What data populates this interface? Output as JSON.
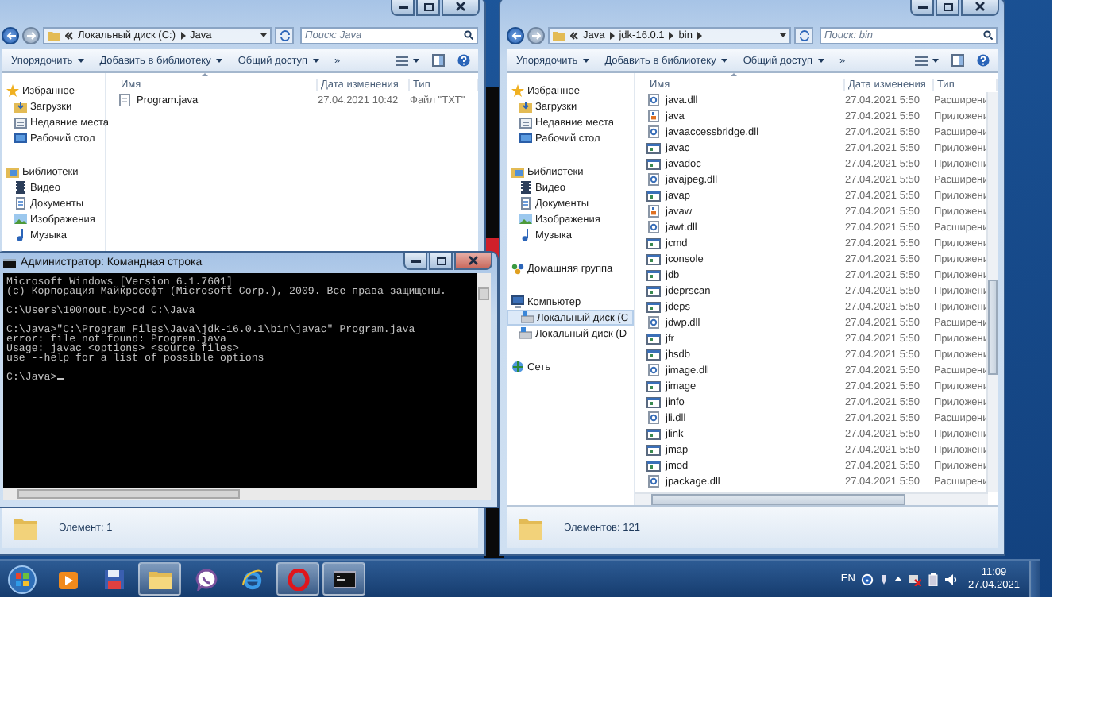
{
  "explorers": [
    {
      "address": {
        "crumbs": [
          "Локальный диск (C:)",
          "Java"
        ],
        "trailing_separator": false
      },
      "search": {
        "placeholder": "Поиск: Java"
      },
      "toolbar": [
        {
          "label": "Упорядочить"
        },
        {
          "label": "Добавить в библиотеку"
        },
        {
          "label": "Общий доступ"
        }
      ],
      "more": "»",
      "nav": [
        {
          "label": "Избранное",
          "kind": "favorites",
          "selected": false,
          "children": [
            {
              "label": "Загрузки",
              "kind": "downloads",
              "selected": false
            },
            {
              "label": "Недавние места",
              "kind": "recent",
              "selected": false
            },
            {
              "label": "Рабочий стол",
              "kind": "desktop",
              "selected": false
            }
          ]
        },
        {
          "label": "Библиотеки",
          "kind": "libraries",
          "selected": false,
          "children": [
            {
              "label": "Видео",
              "kind": "video",
              "selected": false
            },
            {
              "label": "Документы",
              "kind": "documents",
              "selected": false
            },
            {
              "label": "Изображения",
              "kind": "images",
              "selected": false
            },
            {
              "label": "Музыка",
              "kind": "music",
              "selected": false
            }
          ]
        }
      ],
      "columns": [
        "Имя",
        "Дата изменения",
        "Тип"
      ],
      "rows": [
        {
          "name": "Program.java",
          "date": "27.04.2021 10:42",
          "type": "Файл \"TXT\"",
          "kind": "text"
        }
      ],
      "status": "Элемент: 1"
    },
    {
      "address": {
        "crumbs": [
          "Java",
          "jdk-16.0.1",
          "bin"
        ],
        "trailing_separator": true
      },
      "search": {
        "placeholder": "Поиск: bin"
      },
      "toolbar": [
        {
          "label": "Упорядочить"
        },
        {
          "label": "Добавить в библиотеку"
        },
        {
          "label": "Общий доступ"
        }
      ],
      "more": "»",
      "nav": [
        {
          "label": "Избранное",
          "kind": "favorites",
          "selected": false,
          "children": [
            {
              "label": "Загрузки",
              "kind": "downloads",
              "selected": false
            },
            {
              "label": "Недавние места",
              "kind": "recent",
              "selected": false
            },
            {
              "label": "Рабочий стол",
              "kind": "desktop",
              "selected": false
            }
          ]
        },
        {
          "label": "Библиотеки",
          "kind": "libraries",
          "selected": false,
          "children": [
            {
              "label": "Видео",
              "kind": "video",
              "selected": false
            },
            {
              "label": "Документы",
              "kind": "documents",
              "selected": false
            },
            {
              "label": "Изображения",
              "kind": "images",
              "selected": false
            },
            {
              "label": "Музыка",
              "kind": "music",
              "selected": false
            }
          ]
        },
        {
          "label": "Домашняя группа",
          "kind": "homegroup",
          "selected": false
        },
        {
          "label": "Компьютер",
          "kind": "computer",
          "selected": false,
          "children": [
            {
              "label": "Локальный диск (C",
              "kind": "drive",
              "selected": true
            },
            {
              "label": "Локальный диск (D",
              "kind": "drive",
              "selected": false
            }
          ]
        },
        {
          "label": "Сеть",
          "kind": "network",
          "selected": false
        }
      ],
      "columns": [
        "Имя",
        "Дата изменения",
        "Тип"
      ],
      "rows": [
        {
          "name": "java.dll",
          "date": "27.04.2021 5:50",
          "type": "Расширени",
          "kind": "dll"
        },
        {
          "name": "java",
          "date": "27.04.2021 5:50",
          "type": "Приложени",
          "kind": "jar"
        },
        {
          "name": "javaaccessbridge.dll",
          "date": "27.04.2021 5:50",
          "type": "Расширени",
          "kind": "dll"
        },
        {
          "name": "javac",
          "date": "27.04.2021 5:50",
          "type": "Приложени",
          "kind": "exe"
        },
        {
          "name": "javadoc",
          "date": "27.04.2021 5:50",
          "type": "Приложени",
          "kind": "exe"
        },
        {
          "name": "javajpeg.dll",
          "date": "27.04.2021 5:50",
          "type": "Расширени",
          "kind": "dll"
        },
        {
          "name": "javap",
          "date": "27.04.2021 5:50",
          "type": "Приложени",
          "kind": "exe"
        },
        {
          "name": "javaw",
          "date": "27.04.2021 5:50",
          "type": "Приложени",
          "kind": "jar"
        },
        {
          "name": "jawt.dll",
          "date": "27.04.2021 5:50",
          "type": "Расширени",
          "kind": "dll"
        },
        {
          "name": "jcmd",
          "date": "27.04.2021 5:50",
          "type": "Приложени",
          "kind": "exe"
        },
        {
          "name": "jconsole",
          "date": "27.04.2021 5:50",
          "type": "Приложени",
          "kind": "exe"
        },
        {
          "name": "jdb",
          "date": "27.04.2021 5:50",
          "type": "Приложени",
          "kind": "exe"
        },
        {
          "name": "jdeprscan",
          "date": "27.04.2021 5:50",
          "type": "Приложени",
          "kind": "exe"
        },
        {
          "name": "jdeps",
          "date": "27.04.2021 5:50",
          "type": "Приложени",
          "kind": "exe"
        },
        {
          "name": "jdwp.dll",
          "date": "27.04.2021 5:50",
          "type": "Расширени",
          "kind": "dll"
        },
        {
          "name": "jfr",
          "date": "27.04.2021 5:50",
          "type": "Приложени",
          "kind": "exe"
        },
        {
          "name": "jhsdb",
          "date": "27.04.2021 5:50",
          "type": "Приложени",
          "kind": "exe"
        },
        {
          "name": "jimage.dll",
          "date": "27.04.2021 5:50",
          "type": "Расширени",
          "kind": "dll"
        },
        {
          "name": "jimage",
          "date": "27.04.2021 5:50",
          "type": "Приложени",
          "kind": "exe"
        },
        {
          "name": "jinfo",
          "date": "27.04.2021 5:50",
          "type": "Приложени",
          "kind": "exe"
        },
        {
          "name": "jli.dll",
          "date": "27.04.2021 5:50",
          "type": "Расширени",
          "kind": "dll"
        },
        {
          "name": "jlink",
          "date": "27.04.2021 5:50",
          "type": "Приложени",
          "kind": "exe"
        },
        {
          "name": "jmap",
          "date": "27.04.2021 5:50",
          "type": "Приложени",
          "kind": "exe"
        },
        {
          "name": "jmod",
          "date": "27.04.2021 5:50",
          "type": "Приложени",
          "kind": "exe"
        },
        {
          "name": "jpackage.dll",
          "date": "27.04.2021 5:50",
          "type": "Расширени",
          "kind": "dll"
        }
      ],
      "status": "Элементов: 121"
    }
  ],
  "console": {
    "title": "Администратор: Командная строка",
    "blocks": [
      [
        "Microsoft Windows [Version 6.1.7601]",
        "(c) Корпорация Майкрософт (Microsoft Corp.), 2009. Все права защищены."
      ],
      [
        "C:\\Users\\100nout.by>cd C:\\Java"
      ],
      [
        "C:\\Java>\"C:\\Program Files\\Java\\jdk-16.0.1\\bin\\javac\" Program.java",
        "error: file not found: Program.java",
        "Usage: javac <options> <source files>",
        "use --help for a list of possible options"
      ],
      [
        "C:\\Java>"
      ]
    ]
  },
  "taskbar": {
    "apps": [
      {
        "kind": "media",
        "active": false
      },
      {
        "kind": "floppy",
        "active": false
      },
      {
        "kind": "explorer",
        "active": true
      },
      {
        "kind": "viber",
        "active": false
      },
      {
        "kind": "ie",
        "active": false
      },
      {
        "kind": "opera",
        "active": true
      },
      {
        "kind": "console",
        "active": true
      }
    ],
    "language": "EN",
    "time": "11:09",
    "date": "27.04.2021"
  }
}
